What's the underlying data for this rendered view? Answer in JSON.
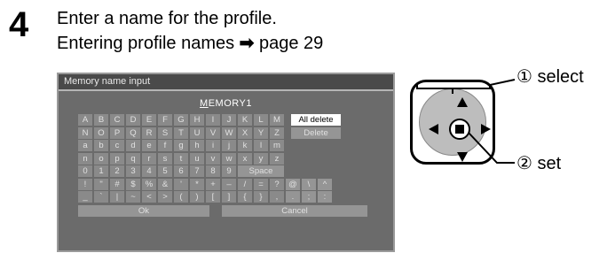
{
  "step": {
    "number": "4"
  },
  "instruction": {
    "line1": "Enter a name for the profile.",
    "line2_text": "Entering profile names",
    "line2_arrow": "➡",
    "line2_ref": "page 29"
  },
  "osd": {
    "title": "Memory name input",
    "value_cursor": "M",
    "value_rest": "EMORY1",
    "rows": [
      [
        "A",
        "B",
        "C",
        "D",
        "E",
        "F",
        "G",
        "H",
        "I",
        "J",
        "K",
        "L",
        "M"
      ],
      [
        "N",
        "O",
        "P",
        "Q",
        "R",
        "S",
        "T",
        "U",
        "V",
        "W",
        "X",
        "Y",
        "Z"
      ],
      [
        "a",
        "b",
        "c",
        "d",
        "e",
        "f",
        "g",
        "h",
        "i",
        "j",
        "k",
        "l",
        "m"
      ],
      [
        "n",
        "o",
        "p",
        "q",
        "r",
        "s",
        "t",
        "u",
        "v",
        "w",
        "x",
        "y",
        "z"
      ],
      [
        "0",
        "1",
        "2",
        "3",
        "4",
        "5",
        "6",
        "7",
        "8",
        "9"
      ],
      [
        "!",
        "\"",
        "#",
        "$",
        "%",
        "&",
        "'",
        "*",
        "+",
        "–",
        "/",
        "=",
        "?",
        "@",
        "\\",
        "^"
      ],
      [
        "_",
        "`",
        "|",
        "~",
        "<",
        ">",
        "(",
        ")",
        "[",
        "]",
        "{",
        "}",
        ",",
        ".",
        ";",
        ":"
      ]
    ],
    "space_label": "Space",
    "all_delete_label": "All delete",
    "delete_label": "Delete",
    "ok_label": "Ok",
    "cancel_label": "Cancel"
  },
  "remote": {
    "select_label": "① select",
    "set_label": "② set",
    "icons": [
      "up-arrow-icon",
      "down-arrow-icon",
      "left-arrow-icon",
      "right-arrow-icon",
      "set-square-icon"
    ]
  }
}
